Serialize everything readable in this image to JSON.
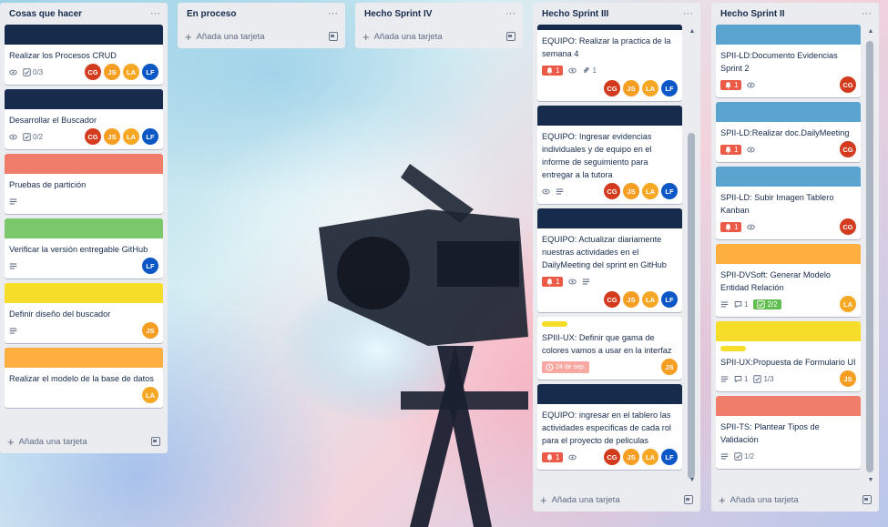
{
  "colors": {
    "navy": "#172b4d",
    "salmon": "#f07c6a",
    "green": "#7bc86c",
    "yellow": "#f5dd29",
    "orange": "#ffaf3f",
    "blue": "#5ba4cf",
    "badge_red": "#eb5a46",
    "badge_green": "#61bd4f"
  },
  "add_card_label": "Añada una tarjeta",
  "lists": [
    {
      "title": "Cosas que hacer",
      "cards": [
        {
          "title": "Realizar los Procesos CRUD",
          "cover": "navy",
          "badges": {
            "watch": true,
            "checklist": "0/3"
          },
          "members": [
            "CG",
            "JS",
            "LA",
            "LF"
          ],
          "members_inline": true
        },
        {
          "title": "Desarrollar el Buscador",
          "cover": "navy",
          "badges": {
            "watch": true,
            "checklist": "0/2"
          },
          "members": [
            "CG",
            "JS",
            "LA",
            "LF"
          ],
          "members_inline": true
        },
        {
          "title": "Pruebas de partición",
          "cover": "salmon",
          "badges": {
            "description": true
          },
          "members": []
        },
        {
          "title": "Verificar la versión entregable GitHub",
          "cover": "green",
          "badges": {
            "description": true
          },
          "members": [
            "LF"
          ],
          "members_inline": true
        },
        {
          "title": "Definir diseño del buscador",
          "cover": "yellow",
          "badges": {
            "description": true
          },
          "members": [
            "JS"
          ],
          "members_inline": true
        },
        {
          "title": "Realizar el modelo de la base de datos",
          "cover": "orange",
          "badges": {},
          "members": [
            "LA"
          ],
          "members_inline": true
        }
      ]
    },
    {
      "title": "En proceso",
      "cards": []
    },
    {
      "title": "Hecho Sprint IV",
      "cards": []
    },
    {
      "title": "Hecho Sprint III",
      "cards": [
        {
          "title": "EQUIPO: Realizar la practica de la semana 4",
          "cover": "navy",
          "cover_clipped": true,
          "badges": {
            "notif": "1",
            "watch": true,
            "attachments": "1"
          },
          "members": [
            "CG",
            "JS",
            "LA",
            "LF"
          ]
        },
        {
          "title": "EQUIPO: Ingresar evidencias individuales y de equipo en el informe de seguimiento para entregar a la tutora",
          "cover": "navy",
          "badges": {
            "watch": true,
            "description": true
          },
          "members": [
            "CG",
            "JS",
            "LA",
            "LF"
          ],
          "members_inline": true
        },
        {
          "title": "EQUIPO: Actualizar diariamente nuestras actividades en el DailyMeeting del sprint en GitHub",
          "cover": "navy",
          "badges": {
            "notif": "1",
            "watch": true,
            "description": true
          },
          "members": [
            "CG",
            "JS",
            "LA",
            "LF"
          ]
        },
        {
          "title": "SPIII-UX: Definir que gama de colores vamos a usar en la interfaz",
          "label": "yellow",
          "badges": {
            "due": "24 de sep."
          },
          "members": [
            "JS"
          ],
          "members_inline": true
        },
        {
          "title": "EQUIPO: ingresar en el tablero las actividades especificas de cada rol para el proyecto de peliculas",
          "cover": "navy",
          "badges": {
            "notif": "1",
            "watch": true
          },
          "members": [
            "CG",
            "JS",
            "LA",
            "LF"
          ],
          "members_inline": true
        }
      ]
    },
    {
      "title": "Hecho Sprint II",
      "cards": [
        {
          "title": "SPII-LD:Documento Evidencias Sprint 2",
          "cover": "blue",
          "badges": {
            "notif": "1",
            "watch": true
          },
          "members": [
            "CG"
          ],
          "members_inline": true
        },
        {
          "title": "SPII-LD:Realizar doc.DailyMeeting",
          "cover": "blue",
          "badges": {
            "notif": "1",
            "watch": true
          },
          "members": [
            "CG"
          ],
          "members_inline": true
        },
        {
          "title": "SPII-LD: Subir Imagen Tablero Kanban",
          "cover": "blue",
          "badges": {
            "notif": "1",
            "watch": true
          },
          "members": [
            "CG"
          ],
          "members_inline": true
        },
        {
          "title": "SPII-DVSoft: Generar Modelo Entidad Relación",
          "cover": "orange",
          "badges": {
            "description": true,
            "comments": "1",
            "checklist_done": "2/2"
          },
          "members": [
            "LA"
          ],
          "members_inline": true
        },
        {
          "title": "SPII-UX:Propuesta de Formulario UI",
          "cover": "yellow",
          "label": "yellow",
          "badges": {
            "description": true,
            "comments": "1",
            "checklist": "1/3"
          },
          "members": [
            "JS"
          ],
          "members_inline": true
        },
        {
          "title": "SPII-TS: Plantear Tipos de Validación",
          "cover": "salmon",
          "badges": {
            "description": true,
            "checklist": "1/2"
          },
          "members": []
        }
      ]
    }
  ]
}
